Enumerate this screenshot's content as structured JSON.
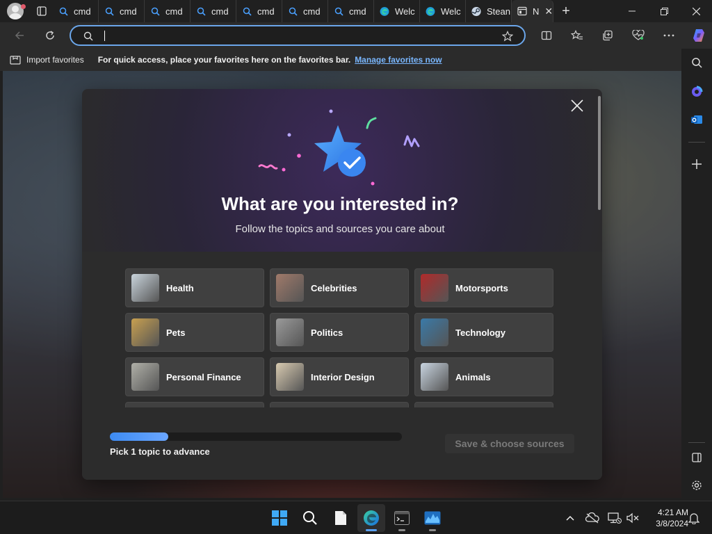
{
  "tabs": [
    {
      "label": "cmd",
      "icon": "search-icon"
    },
    {
      "label": "cmd",
      "icon": "search-icon"
    },
    {
      "label": "cmd",
      "icon": "search-icon"
    },
    {
      "label": "cmd",
      "icon": "search-icon"
    },
    {
      "label": "cmd",
      "icon": "search-icon"
    },
    {
      "label": "cmd",
      "icon": "search-icon"
    },
    {
      "label": "cmd",
      "icon": "search-icon"
    },
    {
      "label": "Welc",
      "icon": "edge-icon"
    },
    {
      "label": "Welc",
      "icon": "edge-icon"
    },
    {
      "label": "Stean",
      "icon": "steam-icon"
    },
    {
      "label": "N",
      "icon": "newtab-icon",
      "active": true
    }
  ],
  "address_bar": {
    "value": "",
    "placeholder": ""
  },
  "favorites_bar": {
    "import_label": "Import favorites",
    "message": "For quick access, place your favorites here on the favorites bar.",
    "manage_link": "Manage favorites now"
  },
  "modal": {
    "title": "What are you interested in?",
    "subtitle": "Follow the topics and sources you care about",
    "topics": [
      {
        "label": "Health",
        "color": "#c9d4dc"
      },
      {
        "label": "Celebrities",
        "color": "#a07a6a"
      },
      {
        "label": "Motorsports",
        "color": "#b02a2a"
      },
      {
        "label": "Pets",
        "color": "#c8a050"
      },
      {
        "label": "Politics",
        "color": "#9a9a9a"
      },
      {
        "label": "Technology",
        "color": "#3a7aa8"
      },
      {
        "label": "Personal Finance",
        "color": "#b0b0a8"
      },
      {
        "label": "Interior Design",
        "color": "#d8cab0"
      },
      {
        "label": "Animals",
        "color": "#c8d4e0"
      }
    ],
    "progress_fraction": 0.2,
    "progress_label": "Pick 1 topic to advance",
    "save_label": "Save & choose sources"
  },
  "clock": {
    "time": "4:21 AM",
    "date": "3/8/2024"
  },
  "colors": {
    "accent": "#6ba6ea",
    "link": "#7ab7ff",
    "progress": "#3d8bf2"
  }
}
